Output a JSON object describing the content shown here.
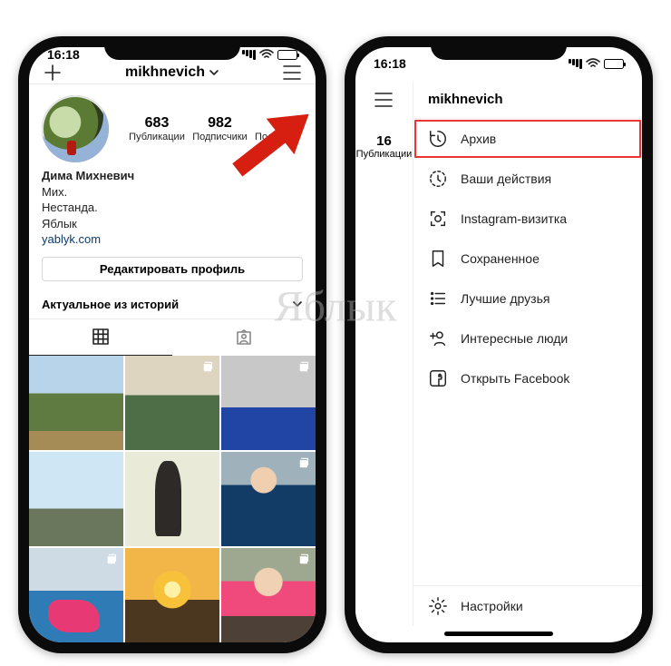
{
  "status": {
    "time": "16:18"
  },
  "profile": {
    "username": "mikhnevich",
    "stats": {
      "posts": {
        "count": "683",
        "label": "Публикации"
      },
      "followers": {
        "count": "982",
        "label": "Подписчики"
      },
      "following": {
        "label": "Подписки"
      }
    },
    "name": "Дима Михневич",
    "bio1": "Мих.",
    "bio2": "Нестанда.",
    "bio3": "Яблык",
    "link": "yablyk.com",
    "edit": "Редактировать профиль",
    "highlights": "Актуальное из историй"
  },
  "right": {
    "username": "mikhnevich",
    "mini": {
      "count": "16",
      "label": "Публикации"
    },
    "menu": {
      "archive": "Архив",
      "activity": "Ваши действия",
      "nametag": "Instagram-визитка",
      "saved": "Сохраненное",
      "close": "Лучшие друзья",
      "discover": "Интересные люди",
      "facebook": "Открыть Facebook",
      "settings": "Настройки"
    }
  },
  "watermark": "Яблык"
}
